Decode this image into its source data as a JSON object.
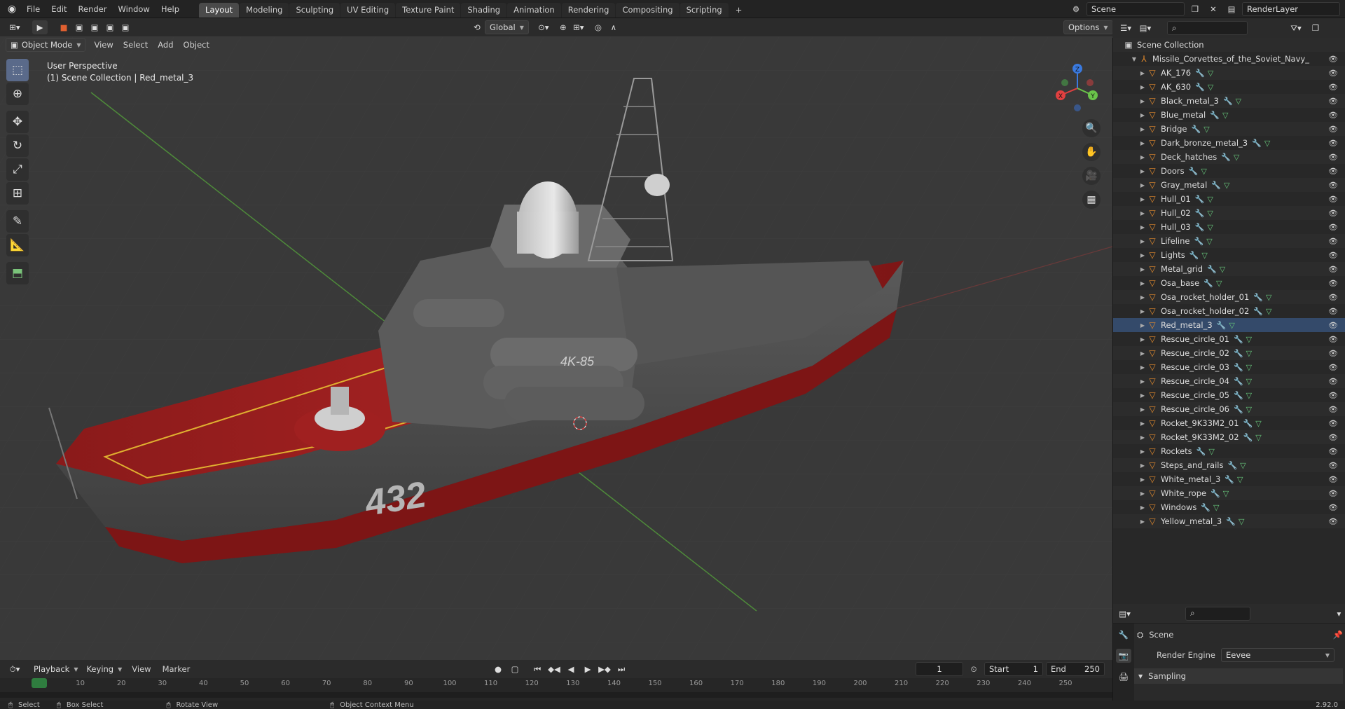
{
  "menus": [
    "File",
    "Edit",
    "Render",
    "Window",
    "Help"
  ],
  "workspaces": [
    "Layout",
    "Modeling",
    "Sculpting",
    "UV Editing",
    "Texture Paint",
    "Shading",
    "Animation",
    "Rendering",
    "Compositing",
    "Scripting"
  ],
  "add_workspace": "+",
  "scene_field": "Scene",
  "renderlayer_field": "RenderLayer",
  "vp_header": {
    "mode": "Object Mode",
    "menus": [
      "View",
      "Select",
      "Add",
      "Object"
    ],
    "transform": "Global",
    "options": "Options"
  },
  "viewport_info": {
    "line1": "User Perspective",
    "line2": "(1) Scene Collection | Red_metal_3"
  },
  "ship": {
    "hull_number": "432",
    "launcher_label": "4K-85"
  },
  "gizmo": {
    "z": "Z",
    "y": "Y",
    "x": "X"
  },
  "outliner": {
    "root": "Scene Collection",
    "collection": "Missile_Corvettes_of_the_Soviet_Navy_Nanu",
    "items": [
      "AK_176",
      "AK_630",
      "Black_metal_3",
      "Blue_metal",
      "Bridge",
      "Dark_bronze_metal_3",
      "Deck_hatches",
      "Doors",
      "Gray_metal",
      "Hull_01",
      "Hull_02",
      "Hull_03",
      "Lifeline",
      "Lights",
      "Metal_grid",
      "Osa_base",
      "Osa_rocket_holder_01",
      "Osa_rocket_holder_02",
      "Red_metal_3",
      "Rescue_circle_01",
      "Rescue_circle_02",
      "Rescue_circle_03",
      "Rescue_circle_04",
      "Rescue_circle_05",
      "Rescue_circle_06",
      "Rocket_9K33M2_01",
      "Rocket_9K33M2_02",
      "Rockets",
      "Steps_and_rails",
      "White_metal_3",
      "White_rope",
      "Windows",
      "Yellow_metal_3"
    ],
    "selected": "Red_metal_3"
  },
  "properties": {
    "scene_label": "Scene",
    "render_engine_label": "Render Engine",
    "render_engine_value": "Eevee",
    "sampling": "Sampling"
  },
  "timeline": {
    "playback": "Playback",
    "keying": "Keying",
    "view": "View",
    "marker": "Marker",
    "current_frame": "1",
    "start_label": "Start",
    "start_value": "1",
    "end_label": "End",
    "end_value": "250",
    "ticks": [
      "1",
      "10",
      "20",
      "30",
      "40",
      "50",
      "60",
      "70",
      "80",
      "90",
      "100",
      "110",
      "120",
      "130",
      "140",
      "150",
      "160",
      "170",
      "180",
      "190",
      "200",
      "210",
      "220",
      "230",
      "240",
      "250"
    ]
  },
  "status": {
    "select": "Select",
    "box_select": "Box Select",
    "rotate_view": "Rotate View",
    "context_menu": "Object Context Menu",
    "version": "2.92.0"
  }
}
